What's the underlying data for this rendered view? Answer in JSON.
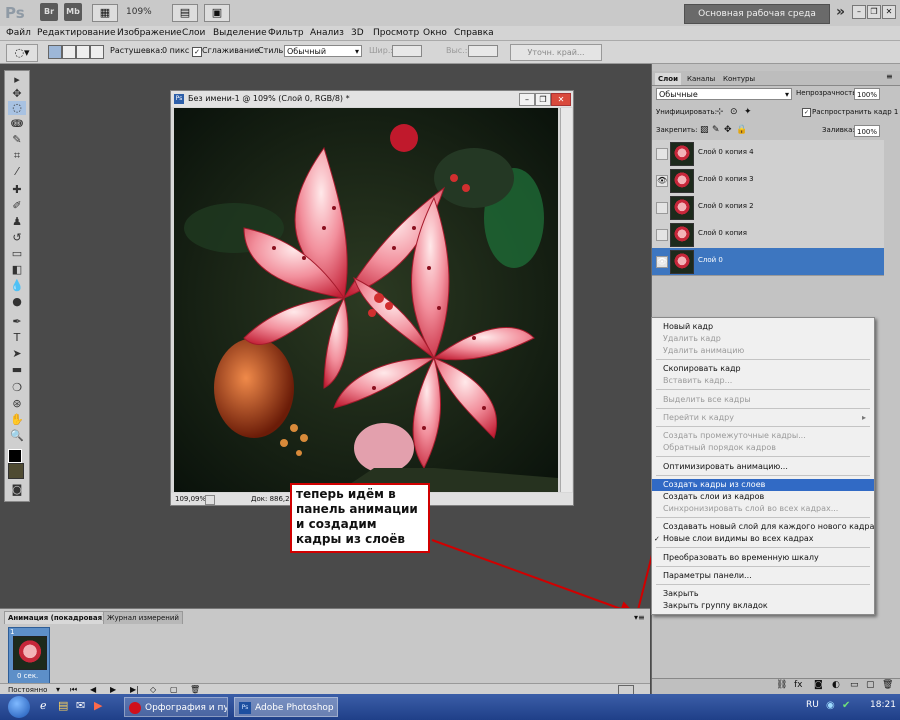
{
  "appbar": {
    "logo": "Ps",
    "br_icon": "Br",
    "mb_icon": "Mb",
    "zoom": "109%",
    "workspace": "Основная рабочая среда",
    "more": "»"
  },
  "menu": [
    "Файл",
    "Редактирование",
    "Изображение",
    "Слои",
    "Выделение",
    "Фильтр",
    "Анализ",
    "3D",
    "Просмотр",
    "Окно",
    "Справка"
  ],
  "options": {
    "feather_label": "Растушевка:",
    "feather_value": "0 пикс",
    "antialias_label": "Сглаживание",
    "style_label": "Стиль:",
    "style_value": "Обычный",
    "width_label": "Шир.:",
    "height_label": "Выс.:",
    "refine_label": "Уточн. край..."
  },
  "document": {
    "title": "Без имени-1 @ 109% (Слой 0, RGB/8) *",
    "zoom": "109,09%",
    "doc_info": "Док: 886,2K/..."
  },
  "callout": {
    "text": "теперь идём в панель анимации и создадим кадры из слоёв"
  },
  "animation_panel": {
    "tabs": [
      "Анимация (покадровая)",
      "Журнал измерений"
    ],
    "frame_number": "1",
    "frame_delay": "0 сек.",
    "loop": "Постоянно"
  },
  "layers_panel": {
    "tabs": [
      "Слои",
      "Каналы",
      "Контуры"
    ],
    "blend_mode": "Обычные",
    "opacity_label": "Непрозрачность:",
    "opacity_value": "100%",
    "unify_label": "Унифицировать:",
    "propagate_label": "Распространить кадр 1",
    "lock_label": "Закрепить:",
    "fill_label": "Заливка:",
    "fill_value": "100%",
    "layers": [
      {
        "name": "Слой 0 копия 4",
        "visible": false,
        "selected": false
      },
      {
        "name": "Слой 0 копия 3",
        "visible": true,
        "selected": false
      },
      {
        "name": "Слой 0 копия 2",
        "visible": false,
        "selected": false
      },
      {
        "name": "Слой 0 копия",
        "visible": false,
        "selected": false
      },
      {
        "name": "Слой 0",
        "visible": true,
        "selected": true
      }
    ]
  },
  "context_menu": {
    "items": [
      "Новый кадр",
      "Удалить кадр",
      "Удалить анимацию",
      "Скопировать кадр",
      "Вставить кадр...",
      "Выделить все кадры",
      "Перейти к кадру",
      "Создать промежуточные кадры...",
      "Обратный порядок кадров",
      "Оптимизировать анимацию...",
      "Создать кадры из слоев",
      "Создать слои из кадров",
      "Синхронизировать слой во всех кадрах...",
      "Создавать новый слой для каждого нового кадра",
      "Новые слои видимы во всех кадрах",
      "Преобразовать во временную шкалу",
      "Параметры панели...",
      "Закрыть",
      "Закрыть группу вкладок"
    ]
  },
  "taskbar": {
    "task1": "Орфография и пу...",
    "task2": "Adobe Photoshop ...",
    "lang": "RU",
    "time": "18:21"
  }
}
